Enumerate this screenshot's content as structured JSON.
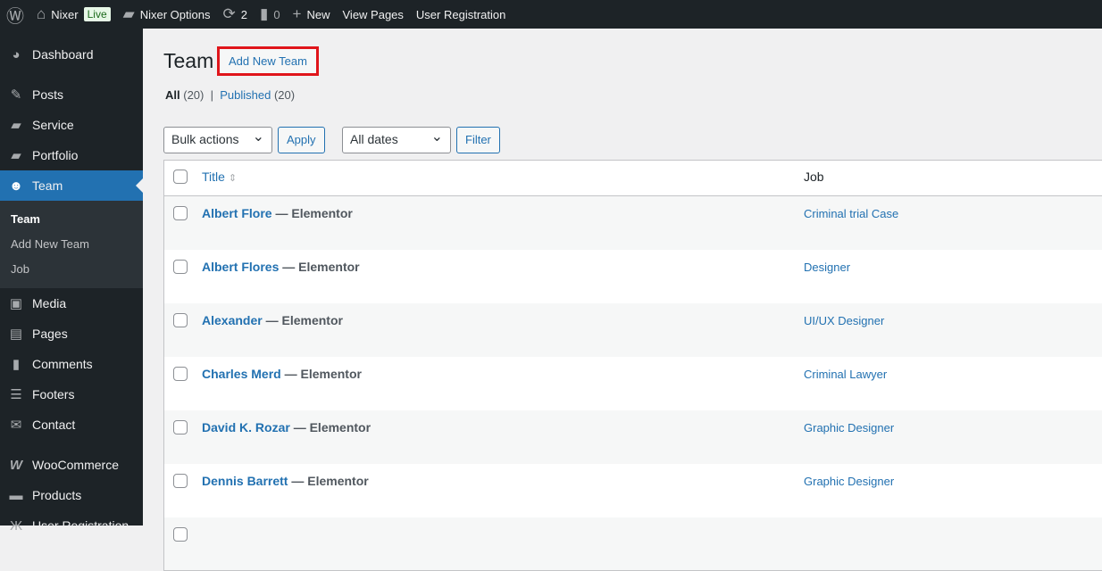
{
  "adminbar": {
    "site": "Nixer",
    "live": "Live",
    "options": "Nixer Options",
    "updates": "2",
    "comments": "0",
    "new": "New",
    "view_pages": "View Pages",
    "user_registration": "User Registration"
  },
  "sidebar": {
    "items": [
      {
        "label": "Dashboard",
        "icon": "dashboard-icon"
      },
      {
        "label": "Posts",
        "icon": "pin-icon"
      },
      {
        "label": "Service",
        "icon": "folder-icon"
      },
      {
        "label": "Portfolio",
        "icon": "folder-icon"
      },
      {
        "label": "Team",
        "icon": "groups-icon"
      },
      {
        "label": "Media",
        "icon": "media-icon"
      },
      {
        "label": "Pages",
        "icon": "pages-icon"
      },
      {
        "label": "Comments",
        "icon": "comment-icon"
      },
      {
        "label": "Footers",
        "icon": "list-icon"
      },
      {
        "label": "Contact",
        "icon": "mail-icon"
      },
      {
        "label": "WooCommerce",
        "icon": "woo-icon"
      },
      {
        "label": "Products",
        "icon": "archive-icon"
      },
      {
        "label": "User Registration",
        "icon": "user-reg-icon"
      }
    ],
    "submenu": [
      "Team",
      "Add New Team",
      "Job"
    ]
  },
  "page": {
    "title": "Team",
    "add_new": "Add New Team",
    "all": "All",
    "all_count": "(20)",
    "published": "Published",
    "published_count": "(20)"
  },
  "filters": {
    "bulk": "Bulk actions",
    "apply": "Apply",
    "dates": "All dates",
    "filter": "Filter"
  },
  "table": {
    "col_title": "Title",
    "col_job": "Job",
    "rows": [
      {
        "title": "Albert Flore",
        "state": "— Elementor",
        "job": "Criminal trial Case"
      },
      {
        "title": "Albert Flores",
        "state": "— Elementor",
        "job": "Designer"
      },
      {
        "title": "Alexander",
        "state": "— Elementor",
        "job": "UI/UX Designer"
      },
      {
        "title": "Charles Merd",
        "state": "— Elementor",
        "job": "Criminal Lawyer"
      },
      {
        "title": "David K. Rozar",
        "state": "— Elementor",
        "job": "Graphic Designer"
      },
      {
        "title": "Dennis Barrett",
        "state": "— Elementor",
        "job": "Graphic Designer"
      }
    ]
  }
}
